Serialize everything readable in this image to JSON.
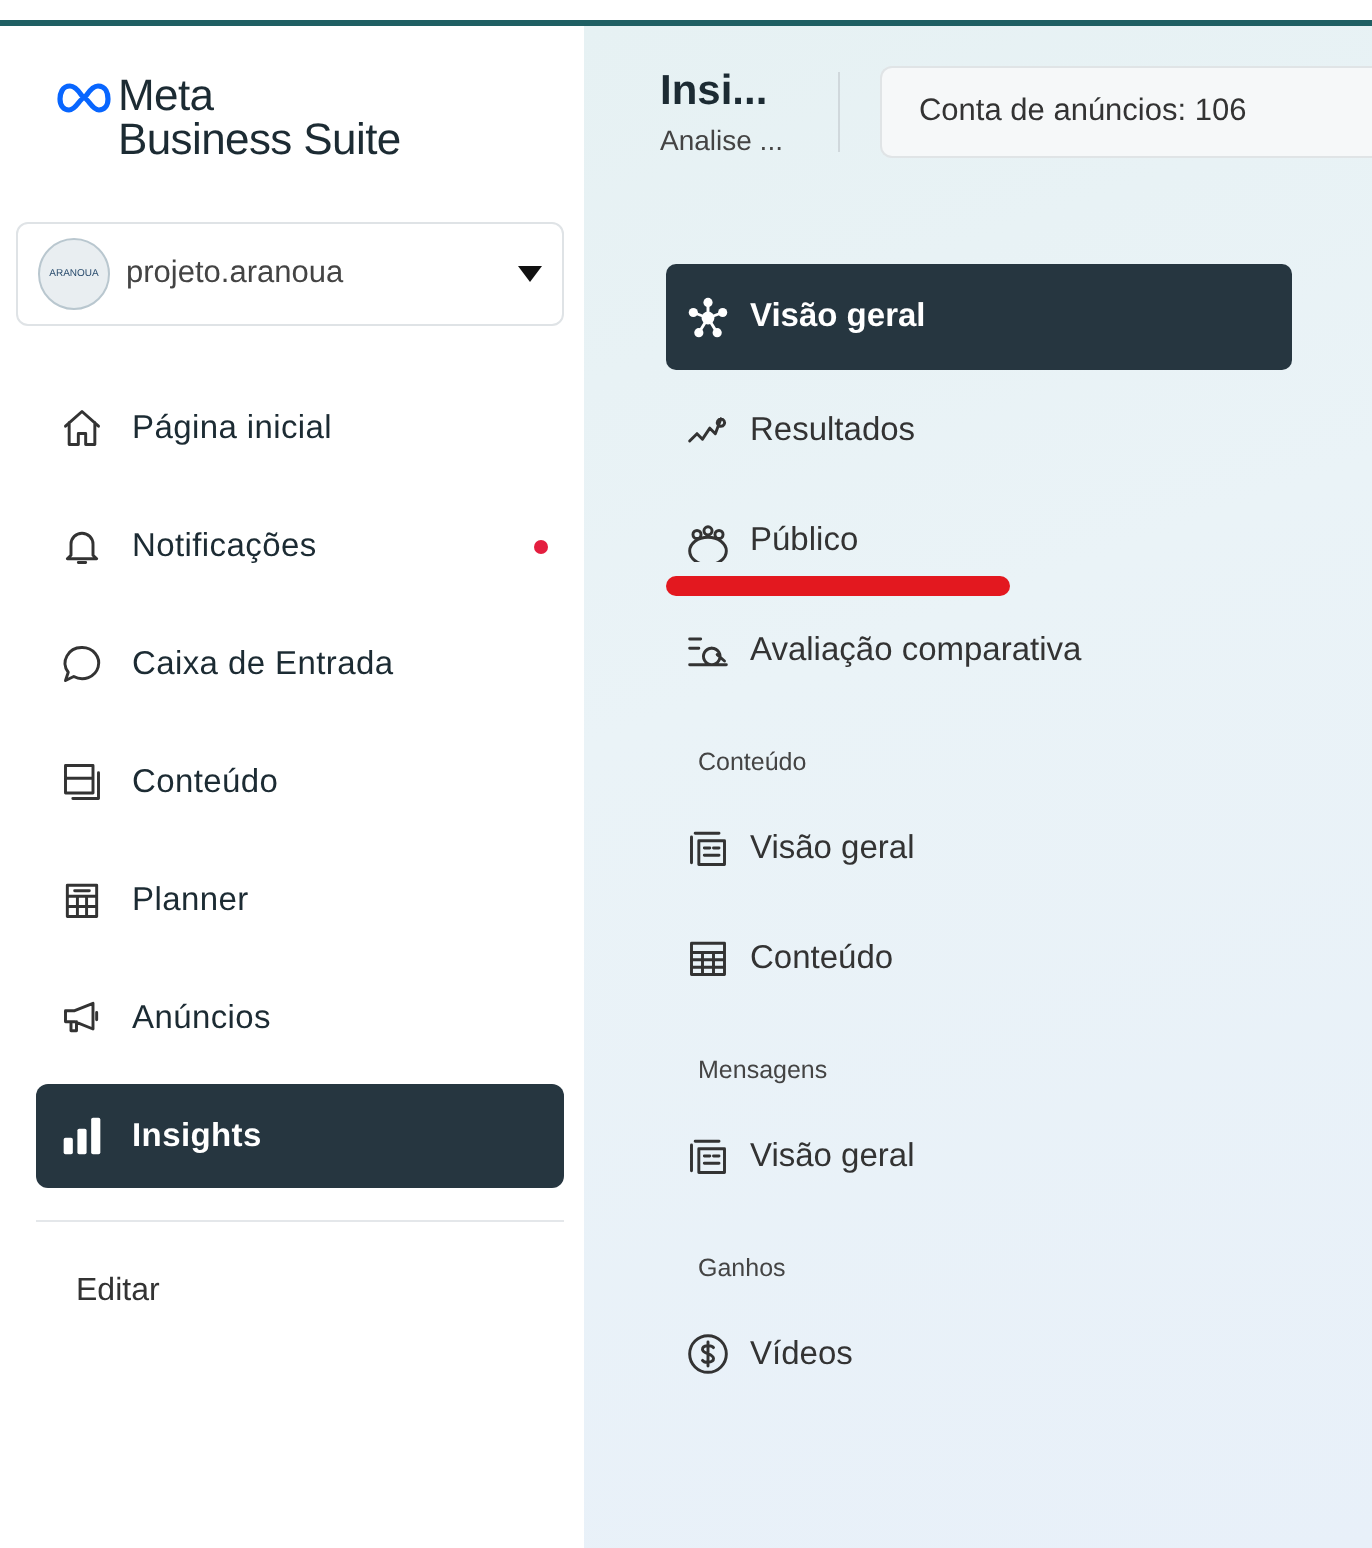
{
  "sidebar": {
    "logo": {
      "line1": "Meta",
      "line2": "Business Suite"
    },
    "account": {
      "name": "projeto.aranoua",
      "avatar_text": "ARANOUA"
    },
    "items": [
      {
        "label": "Página inicial",
        "selected": false,
        "unread": false
      },
      {
        "label": "Notificações",
        "selected": false,
        "unread": true
      },
      {
        "label": "Caixa de Entrada",
        "selected": false,
        "unread": false
      },
      {
        "label": "Conteúdo",
        "selected": false,
        "unread": false
      },
      {
        "label": "Planner",
        "selected": false,
        "unread": false
      },
      {
        "label": "Anúncios",
        "selected": false,
        "unread": false
      },
      {
        "label": "Insights",
        "selected": true,
        "unread": false
      }
    ],
    "edit_link": "Editar"
  },
  "header": {
    "title": "Insi...",
    "subtitle": "Analise ...",
    "account_field": "Conta de anúncios: 106"
  },
  "subnav": [
    {
      "items": [
        {
          "label": "Visão geral",
          "selected": true,
          "underlined": false
        },
        {
          "label": "Resultados",
          "selected": false,
          "underlined": false
        },
        {
          "label": "Público",
          "selected": false,
          "underlined": true
        },
        {
          "label": "Avaliação comparativa",
          "selected": false,
          "underlined": false
        }
      ]
    },
    {
      "heading": "Conteúdo",
      "items": [
        {
          "label": "Visão geral",
          "selected": false,
          "underlined": false
        },
        {
          "label": "Conteúdo",
          "selected": false,
          "underlined": false
        }
      ]
    },
    {
      "heading": "Mensagens",
      "items": [
        {
          "label": "Visão geral",
          "selected": false,
          "underlined": false
        }
      ]
    },
    {
      "heading": "Ganhos",
      "items": [
        {
          "label": "Vídeos",
          "selected": false,
          "underlined": false
        }
      ]
    }
  ]
}
